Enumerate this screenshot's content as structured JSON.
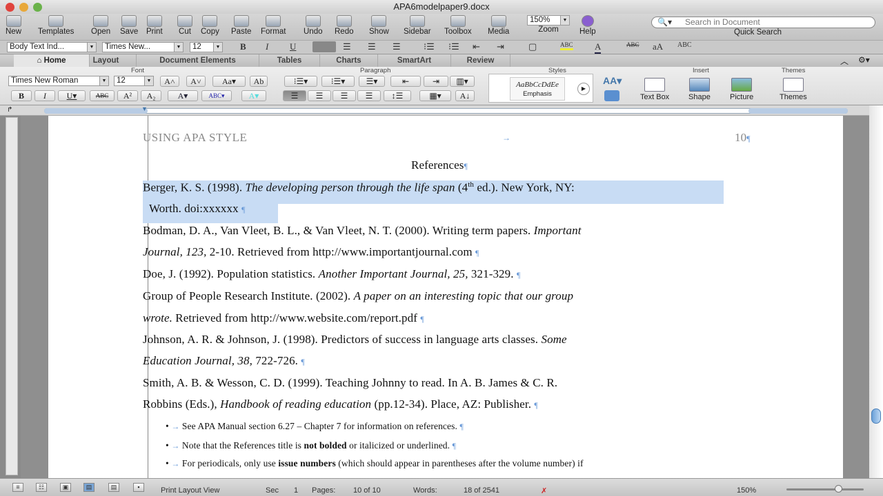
{
  "window": {
    "title": "APA6modelpaper9.docx"
  },
  "toolbar": {
    "items": [
      "New",
      "Templates",
      "Open",
      "Save",
      "Print",
      "Cut",
      "Copy",
      "Paste",
      "Format",
      "Undo",
      "Redo",
      "Show",
      "Sidebar",
      "Toolbox",
      "Media"
    ],
    "zoom_value": "150%",
    "zoom_label": "Zoom",
    "help_label": "Help",
    "search_placeholder": "Search in Document",
    "search_label": "Quick Search"
  },
  "format_bar": {
    "style": "Body Text Ind...",
    "font": "Times New...",
    "size": "12"
  },
  "tabs": [
    "Home",
    "Layout",
    "Document Elements",
    "Tables",
    "Charts",
    "SmartArt",
    "Review"
  ],
  "ribbon": {
    "groups": [
      "Font",
      "Paragraph",
      "Styles",
      "Insert",
      "Themes"
    ],
    "font": "Times New Roman",
    "size": "12",
    "style_preview": "AaBbCcDdEe",
    "style_name": "Emphasis",
    "insert": [
      "Text Box",
      "Shape",
      "Picture"
    ],
    "themes": "Themes"
  },
  "document": {
    "header_left": "USING APA STYLE",
    "page_number": "10",
    "title": "References",
    "lines": [
      [
        {
          "t": "Berger, K. S. (1998).  "
        },
        {
          "t": "The developing person through the life span",
          "i": 1
        },
        {
          "t": " (4"
        },
        {
          "t": "th",
          "sup": 1
        },
        {
          "t": " ed.).",
          "i": 0
        },
        {
          "t": "  New York, NY:"
        }
      ],
      [
        {
          "t": "Worth. doi:xxxxxx"
        }
      ],
      [
        {
          "t": "Bodman, D. A., Van Vleet, B. L., & Van Vleet, N. T. (2000).  Writing term papers.  "
        },
        {
          "t": "Important",
          "i": 1
        }
      ],
      [
        {
          "t": "Journal, 123,",
          "i": 1
        },
        {
          "t": " 2-10. Retrieved from http://www.importantjournal.com"
        }
      ],
      [
        {
          "t": "Doe, J. (1992).  Population statistics.  "
        },
        {
          "t": "Another Important Journal, 25,",
          "i": 1
        },
        {
          "t": " 321-329."
        }
      ],
      [
        {
          "t": "Group of People Research Institute.  (2002). "
        },
        {
          "t": "A paper on an interesting topic that our group",
          "i": 1
        }
      ],
      [
        {
          "t": "wrote.",
          "i": 1
        },
        {
          "t": "  Retrieved from http://www.website.com/report.pdf"
        }
      ],
      [
        {
          "t": "Johnson, A. R. & Johnson, J. (1998). Predictors of success in language arts classes.  "
        },
        {
          "t": "Some",
          "i": 1
        }
      ],
      [
        {
          "t": "Education Journal, 38,",
          "i": 1
        },
        {
          "t": " 722-726."
        }
      ],
      [
        {
          "t": "Smith, A. B. & Wesson, C. D. (1999).  Teaching Johnny to read.  In A. B. James & C. R."
        }
      ],
      [
        {
          "t": "Robbins (Eds.), "
        },
        {
          "t": "Handbook of reading education",
          "i": 1
        },
        {
          "t": " (pp.12-34).  Place, AZ:  Publisher."
        }
      ]
    ],
    "bullets": [
      [
        {
          "t": "See APA Manual section 6.27 – Chapter 7 for information on references."
        }
      ],
      [
        {
          "t": "Note that the References title is "
        },
        {
          "t": "not bolded",
          "b": 1
        },
        {
          "t": " or italicized or underlined."
        }
      ],
      [
        {
          "t": "For periodicals, only use "
        },
        {
          "t": "issue numbers",
          "b": 1
        },
        {
          "t": " (which should appear in parentheses after the volume number) if"
        }
      ]
    ],
    "pilcrow": "¶",
    "tab_arrow": "→",
    "bullet": "•"
  },
  "status": {
    "view": "Print Layout View",
    "sec_label": "Sec",
    "sec": "1",
    "pages_label": "Pages:",
    "pages": "10 of 10",
    "words_label": "Words:",
    "words": "18 of 2541",
    "zoom": "150%"
  }
}
